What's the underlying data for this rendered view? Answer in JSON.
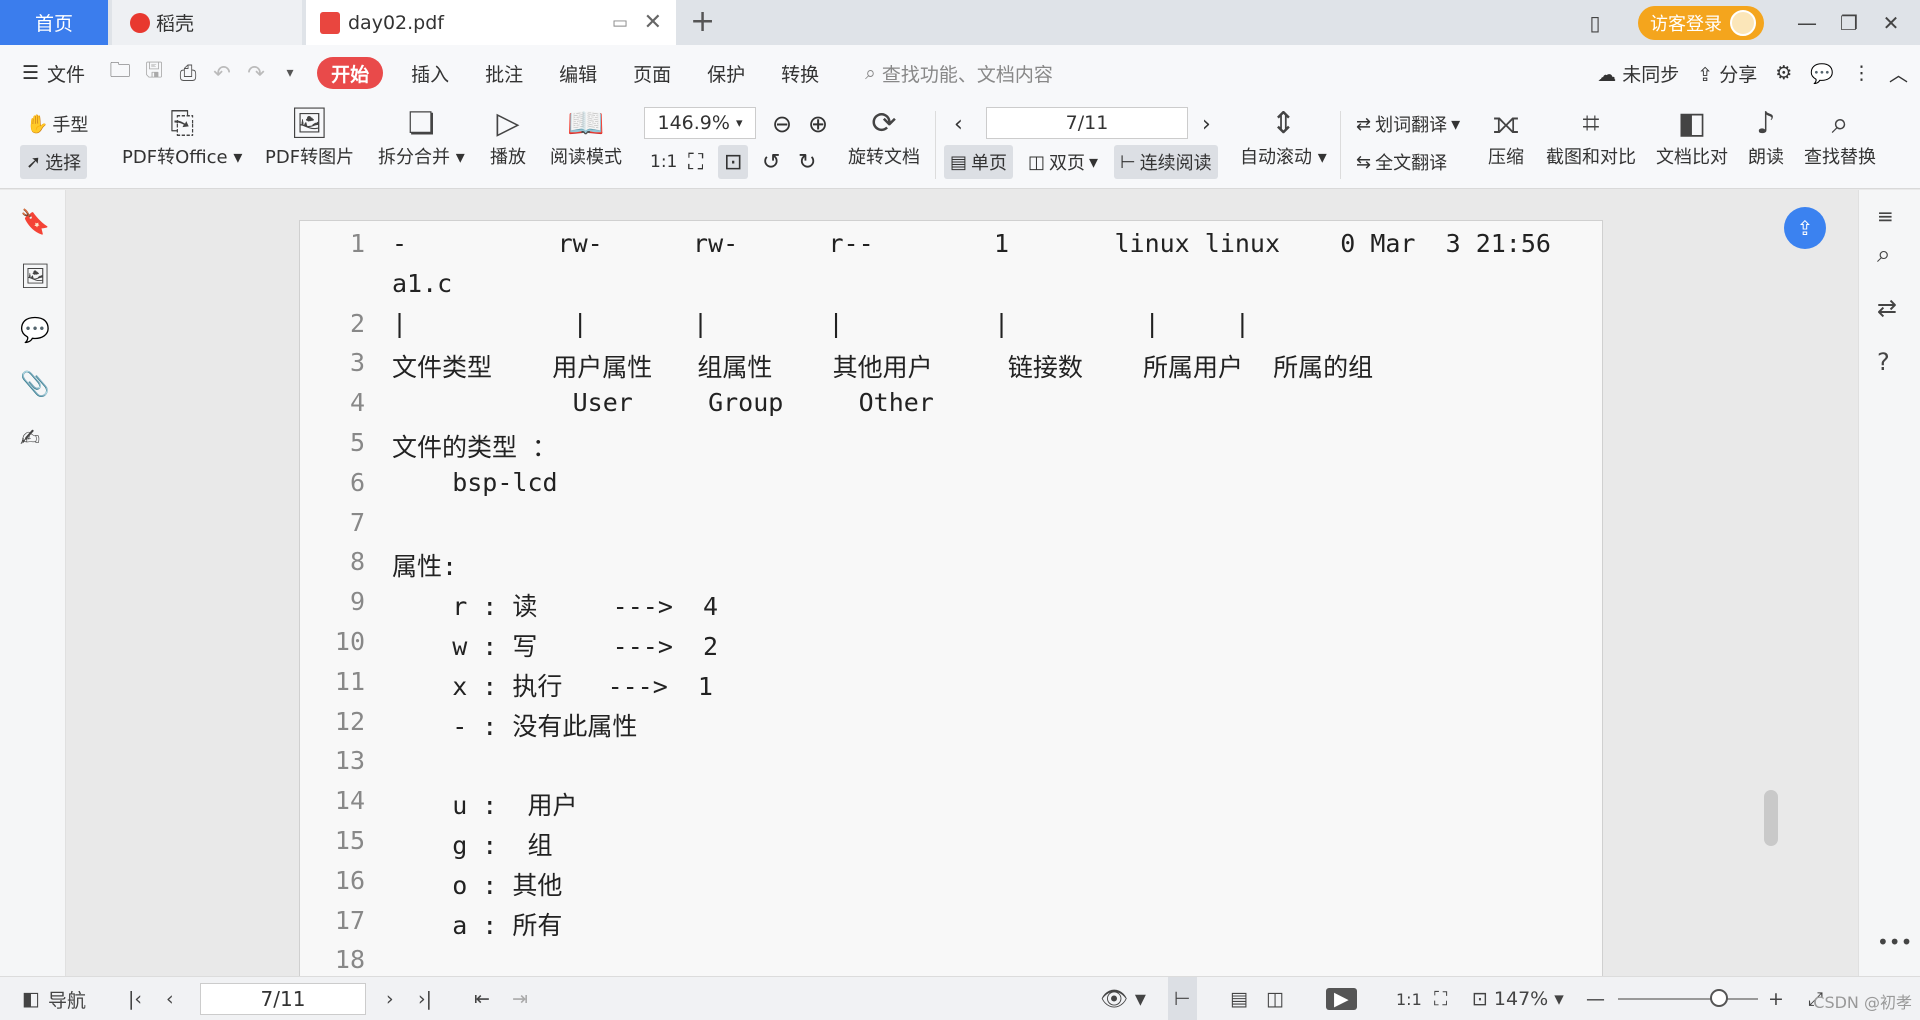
{
  "tabs": {
    "home": "首页",
    "daoke": "稻壳",
    "pdf": "day02.pdf"
  },
  "titlebar": {
    "guest_login": "访客登录"
  },
  "menu": {
    "file": "文件",
    "items": [
      "开始",
      "插入",
      "批注",
      "编辑",
      "页面",
      "保护",
      "转换"
    ],
    "search_placeholder": "查找功能、文档内容",
    "unsynced": "未同步",
    "share": "分享"
  },
  "ribbon": {
    "hand": "手型",
    "select": "选择",
    "pdf_to_office": "PDF转Office",
    "pdf_to_image": "PDF转图片",
    "split_merge": "拆分合并",
    "play": "播放",
    "read_mode": "阅读模式",
    "zoom": "146.9%",
    "rotate_doc": "旋转文档",
    "page_indicator": "7/11",
    "single_page": "单页",
    "double_page": "双页",
    "continuous": "连续阅读",
    "auto_scroll": "自动滚动",
    "word_translate": "划词翻译",
    "full_translate": "全文翻译",
    "compress": "压缩",
    "screenshot_compare": "截图和对比",
    "doc_compare": "文档比对",
    "read_aloud": "朗读",
    "find_replace": "查找替换"
  },
  "document": {
    "lines": [
      {
        "n": "1",
        "text": "-          rw-      rw-      r--        1       linux linux    0 Mar  3 21:56"
      },
      {
        "n": "",
        "text": "a1.c"
      },
      {
        "n": "2",
        "text": "|           |       |        |          |         |     |"
      },
      {
        "n": "3",
        "text": "文件类型    用户属性   组属性    其他用户     链接数    所属用户  所属的组"
      },
      {
        "n": "4",
        "text": "            User     Group     Other"
      },
      {
        "n": "5",
        "text": "文件的类型 ："
      },
      {
        "n": "6",
        "text": "    bsp-lcd"
      },
      {
        "n": "7",
        "text": ""
      },
      {
        "n": "8",
        "text": "属性:"
      },
      {
        "n": "9",
        "text": "    r : 读     --->  4"
      },
      {
        "n": "10",
        "text": "    w : 写     --->  2"
      },
      {
        "n": "11",
        "text": "    x : 执行   --->  1"
      },
      {
        "n": "12",
        "text": "    - : 没有此属性"
      },
      {
        "n": "13",
        "text": ""
      },
      {
        "n": "14",
        "text": "    u :  用户"
      },
      {
        "n": "15",
        "text": "    g :  组"
      },
      {
        "n": "16",
        "text": "    o : 其他"
      },
      {
        "n": "17",
        "text": "    a : 所有"
      },
      {
        "n": "18",
        "text": ""
      }
    ]
  },
  "status": {
    "nav": "导航",
    "page": "7/11",
    "zoom": "147%",
    "zoom_level": 0.72,
    "watermark": "CSDN @初孝"
  }
}
